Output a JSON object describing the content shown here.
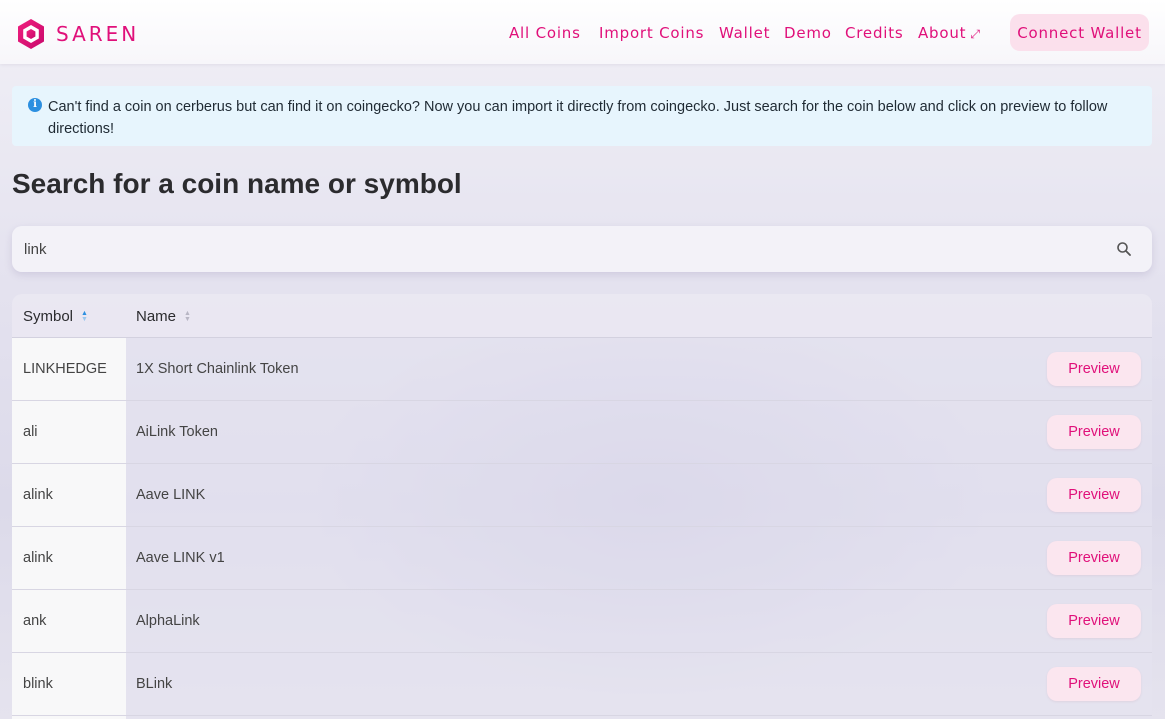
{
  "brand": {
    "name": "SAREN",
    "accent": "#e0107a"
  },
  "nav": {
    "items": [
      {
        "label": "All Coins"
      },
      {
        "label": "Import Coins"
      },
      {
        "label": "Wallet"
      },
      {
        "label": "Demo"
      },
      {
        "label": "Credits"
      },
      {
        "label": "About",
        "icon": "external-link-icon"
      }
    ],
    "connect_label": "Connect Wallet"
  },
  "info": {
    "icon": "info-icon",
    "text": "Can't find a coin on cerberus but can find it on coingecko? Now you can import it directly from coingecko. Just search for the coin below and click on preview to follow directions!"
  },
  "page_title": "Search for a coin name or symbol",
  "search": {
    "value": "link",
    "icon": "search-icon"
  },
  "table": {
    "columns": [
      {
        "label": "Symbol",
        "sort": "ascending"
      },
      {
        "label": "Name",
        "sort": "none"
      }
    ],
    "rows": [
      {
        "symbol": "LINKHEDGE",
        "name": "1X Short Chainlink Token",
        "action": "Preview"
      },
      {
        "symbol": "ali",
        "name": "AiLink Token",
        "action": "Preview"
      },
      {
        "symbol": "alink",
        "name": "Aave LINK",
        "action": "Preview"
      },
      {
        "symbol": "alink",
        "name": "Aave LINK v1",
        "action": "Preview"
      },
      {
        "symbol": "ank",
        "name": "AlphaLink",
        "action": "Preview"
      },
      {
        "symbol": "blink",
        "name": "BLink",
        "action": "Preview"
      }
    ]
  }
}
